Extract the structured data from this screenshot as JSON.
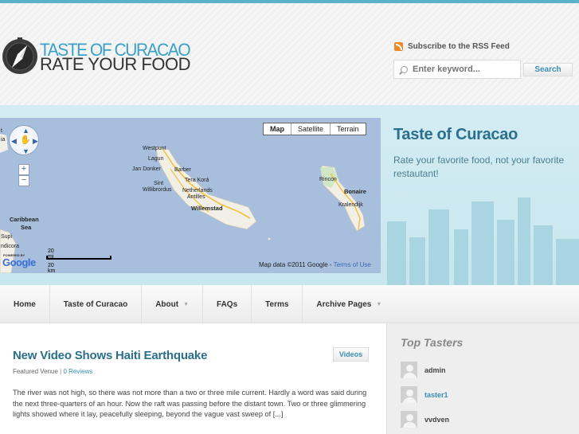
{
  "header": {
    "logo_line1": "TASTE OF CURACAO",
    "logo_line2": "RATE YOUR FOOD",
    "rss_label": "Subscribe to the RSS Feed",
    "search_placeholder": "Enter keyword...",
    "search_button": "Search"
  },
  "map": {
    "types": [
      "Map",
      "Satellite",
      "Terrain"
    ],
    "selected_type": "Map",
    "labels": {
      "westpunt": "Westpunt",
      "lagun": "Lagun",
      "jandonker": "Jan Donker",
      "barber": "Barber",
      "terakora": "Tera Korá",
      "sint": "Sint",
      "willibrordus": "Willibrordus",
      "netherlands": "Netherlands",
      "antilles": "Antilles",
      "willemstad": "Willemstad",
      "rincon": "Rincon",
      "bonaire": "Bonaire",
      "kralendijk": "Kralendijk",
      "caribbean": "Caribbean",
      "sea": "Sea",
      "supi": "Supi",
      "ndicora": "ndicora",
      "tl": "t",
      "ia": "ia"
    },
    "scale_mi": "20 mi",
    "scale_km": "20 km",
    "powered_by": "POWERED BY",
    "google": "Google",
    "credit": "Map data ©2011 Google - ",
    "terms": "Terms of Use"
  },
  "hero": {
    "title": "Taste of Curacao",
    "subtitle": "Rate your favorite food, not your favorite restautant!"
  },
  "nav": {
    "items": [
      {
        "label": "Home"
      },
      {
        "label": "Taste of Curacao"
      },
      {
        "label": "About"
      },
      {
        "label": "FAQs"
      },
      {
        "label": "Terms"
      },
      {
        "label": "Archive Pages"
      }
    ]
  },
  "post": {
    "title": "New Video Shows Haiti Earthquake",
    "category_button": "Videos",
    "meta_category": "Featured Venue",
    "meta_sep": " | ",
    "meta_reviews": "0 Reviews",
    "excerpt": "The river was not high, so there was not more than a two or three mile current. Hardly a word was said during the next three-quarters of an hour. Now the raft was passing before the distant town. Two or three glimmering lights showed where it lay, peacefully sleeping, beyond the vague vast sweep of [...]"
  },
  "sidebar": {
    "title": "Top Tasters",
    "tasters": [
      {
        "name": "admin"
      },
      {
        "name": "taster1"
      },
      {
        "name": "vvdven"
      }
    ]
  },
  "colors": {
    "accent": "#3a8fb5",
    "top_bar": "#5ab2c9",
    "hero_bg": "#cde9f1",
    "map_water": "#a7bfdd",
    "rss": "#e98a2b"
  }
}
